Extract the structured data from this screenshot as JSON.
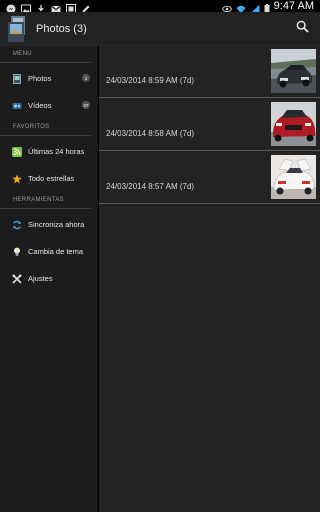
{
  "status_bar": {
    "time": "9:47 AM",
    "left_icons": [
      "messenger-icon",
      "image-icon",
      "download-icon",
      "gmail-icon",
      "gallery-icon",
      "pen-icon"
    ],
    "right_icons": [
      "eye-icon",
      "wifi-icon",
      "signal-icon",
      "battery-icon"
    ]
  },
  "action_bar": {
    "title": "Photos (3)",
    "search_icon": "search-icon"
  },
  "drawer": {
    "sections": [
      {
        "title": "MENU",
        "items": [
          {
            "label": "Photos",
            "icon": "photos-icon",
            "badge": "1"
          },
          {
            "label": "Vídeos",
            "icon": "videos-icon",
            "badge": "27"
          }
        ]
      },
      {
        "title": "FAVORITOS",
        "items": [
          {
            "label": "Últimas 24 horas",
            "icon": "rss-icon"
          },
          {
            "label": "Todo estrellas",
            "icon": "star-icon"
          }
        ]
      },
      {
        "title": "HERRAMIENTAS",
        "items": [
          {
            "label": "Sincroniza ahora",
            "icon": "sync-icon"
          },
          {
            "label": "Cambia de tema",
            "icon": "lightbulb-icon"
          },
          {
            "label": "Ajustes",
            "icon": "tools-icon"
          }
        ]
      }
    ]
  },
  "photos": [
    {
      "date": "24/03/2014 8:59 AM (7d)",
      "thumb": "car-gray-thumbnail"
    },
    {
      "date": "24/03/2014 8:58 AM (7d)",
      "thumb": "car-red-thumbnail"
    },
    {
      "date": "24/03/2014 8:57 AM (7d)",
      "thumb": "car-white-thumbnail"
    }
  ],
  "colors": {
    "action_bar": "#222222",
    "drawer": "#1c1c1c",
    "content": "#232323",
    "divider": "#555555",
    "star": "#f5a623",
    "rss": "#7cc040",
    "sync": "#4aa3df"
  }
}
